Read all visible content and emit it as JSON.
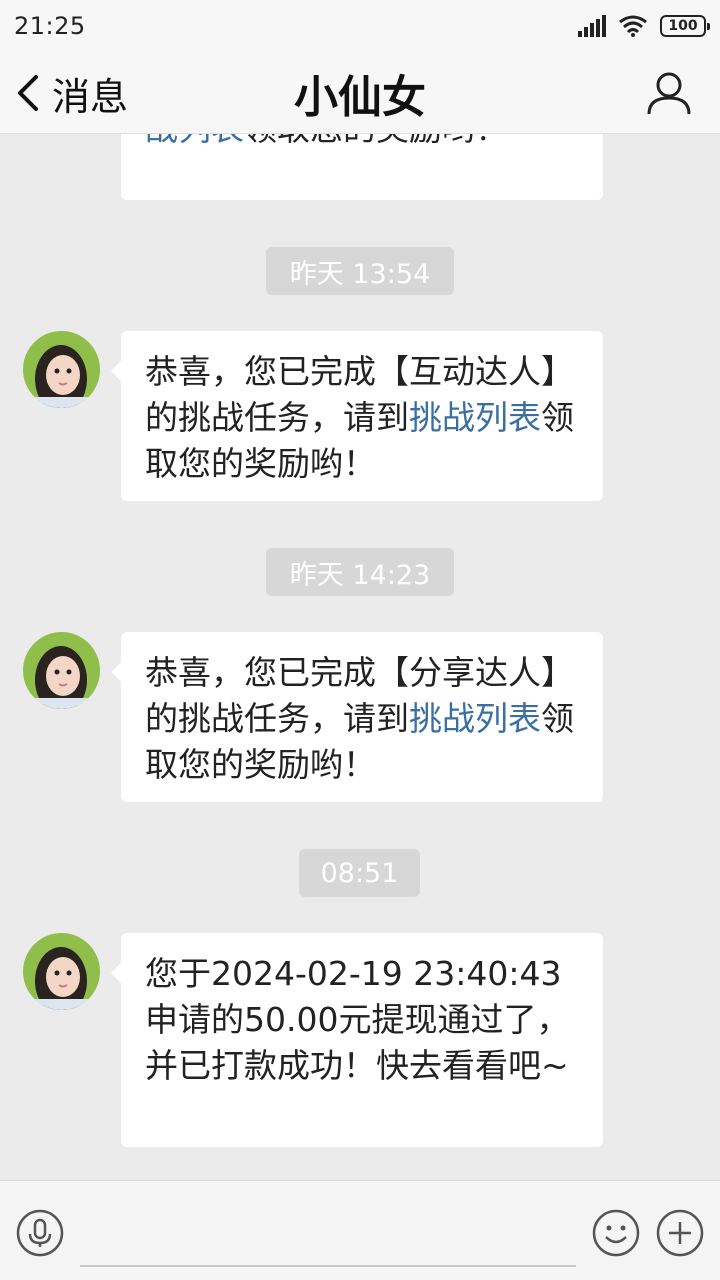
{
  "status": {
    "time": "21:25",
    "battery": "100",
    "icons": [
      "signal-icon",
      "wifi-icon",
      "battery-icon"
    ]
  },
  "nav": {
    "back_label": "消息",
    "title": "小仙女",
    "back_icon": "chevron-left-icon",
    "profile_icon": "person-icon"
  },
  "messages": {
    "m0": {
      "line": "领取您的奖励哟！",
      "link": "战列表"
    },
    "t1": "昨天 13:54",
    "m1": {
      "prefix": "恭喜，您已完成【互动达人】的挑战任务，请到",
      "link": "挑战列表",
      "suffix": "领取您的奖励哟！"
    },
    "t2": "昨天 14:23",
    "m2": {
      "prefix": "恭喜，您已完成【分享达人】的挑战任务，请到",
      "link": "挑战列表",
      "suffix": "领取您的奖励哟！"
    },
    "t3": "08:51",
    "m3": {
      "text": "您于2024-02-19 23:40:43申请的50.00元提现通过了，并已打款成功！快去看看吧~"
    }
  },
  "input_bar": {
    "placeholder": "",
    "icons": [
      "microphone-icon",
      "emoji-icon",
      "plus-icon"
    ]
  },
  "colors": {
    "background": "#ebebeb",
    "bubble": "#ffffff",
    "link": "#3b6fa3",
    "time_pill": "#d7d7d7"
  }
}
